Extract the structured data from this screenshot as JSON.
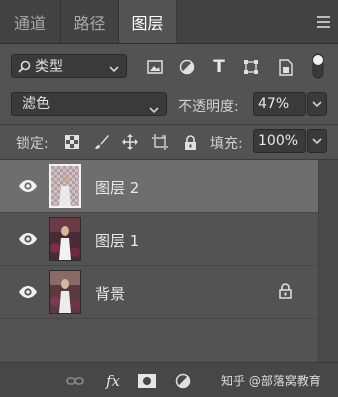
{
  "tabs": [
    {
      "label": "通道",
      "active": false
    },
    {
      "label": "路径",
      "active": false
    },
    {
      "label": "图层",
      "active": true
    }
  ],
  "filter": {
    "kind_label": "类型",
    "icons": [
      "image-filter-icon",
      "adjustment-filter-icon",
      "type-filter-icon",
      "shape-filter-icon",
      "smart-object-filter-icon",
      "filter-toggle-icon"
    ]
  },
  "blend": {
    "mode": "滤色",
    "opacity_label": "不透明度:",
    "opacity_value": "47%"
  },
  "lock": {
    "label": "锁定:",
    "icons": [
      "lock-transparent-pixels-icon",
      "lock-image-pixels-icon",
      "lock-position-icon",
      "lock-artboard-icon",
      "lock-all-icon"
    ],
    "fill_label": "填充:",
    "fill_value": "100%"
  },
  "layers": [
    {
      "name": "图层 2",
      "selected": true,
      "visible": true,
      "locked": false
    },
    {
      "name": "图层 1",
      "selected": false,
      "visible": true,
      "locked": false
    },
    {
      "name": "背景",
      "selected": false,
      "visible": true,
      "locked": true
    }
  ],
  "bottom": {
    "icons": [
      "link-layers-icon",
      "layer-style-fx-icon",
      "add-mask-icon",
      "adjustment-layer-icon"
    ],
    "fx_label": "fx",
    "watermark": "知乎 @部落窝教育"
  },
  "colors": {
    "panel_bg": "#535353",
    "tab_bar_bg": "#424242",
    "selected_row": "#6e6e6e",
    "field_bg": "#3a3a3a"
  }
}
